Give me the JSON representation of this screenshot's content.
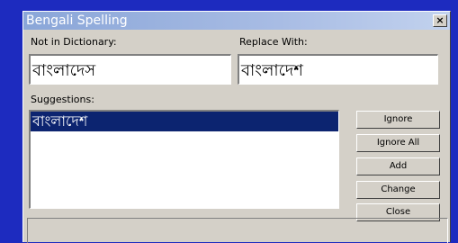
{
  "window": {
    "title": "Bengali Spelling",
    "close_glyph": "×"
  },
  "not_in_dictionary": {
    "label": "Not in Dictionary:",
    "value": "বাংলাদেস"
  },
  "replace_with": {
    "label": "Replace With:",
    "value": "বাংলাদেশ"
  },
  "suggestions": {
    "label": "Suggestions:",
    "items": [
      "বাংলাদেশ"
    ],
    "selected_index": 0
  },
  "buttons": {
    "ignore": "Ignore",
    "ignore_all": "Ignore All",
    "add": "Add",
    "change": "Change",
    "close": "Close"
  },
  "colors": {
    "desktop": "#1d2bbf",
    "selection": "#0c2470",
    "dialog_face": "#d4d0c8"
  }
}
